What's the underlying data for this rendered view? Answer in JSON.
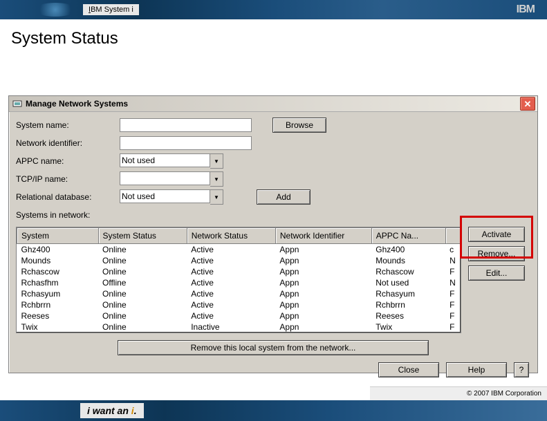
{
  "banner": {
    "label": "IBM System i",
    "logo": "IBM"
  },
  "page_title": "System Status",
  "dialog": {
    "title": "Manage Network Systems",
    "fields": {
      "system_name_label": "System name:",
      "system_name_value": "",
      "network_identifier_label": "Network identifier:",
      "network_identifier_value": "",
      "appc_name_label": "APPC name:",
      "appc_name_value": "Not used",
      "tcpip_name_label": "TCP/IP name:",
      "tcpip_name_value": "",
      "relational_db_label": "Relational database:",
      "relational_db_value": "Not used",
      "systems_in_network_label": "Systems in network:"
    },
    "buttons": {
      "browse": "Browse",
      "add": "Add",
      "activate": "Activate",
      "remove": "Remove...",
      "edit": "Edit...",
      "remove_local": "Remove this local system from the network...",
      "close": "Close",
      "help": "Help",
      "q": "?"
    },
    "table": {
      "headers": [
        "System",
        "System Status",
        "Network Status",
        "Network Identifier",
        "APPC Na...",
        ""
      ],
      "rows": [
        [
          "Ghz400",
          "Online",
          "Active",
          "Appn",
          "Ghz400",
          "c"
        ],
        [
          "Mounds",
          "Online",
          "Active",
          "Appn",
          "Mounds",
          "N"
        ],
        [
          "Rchascow",
          "Online",
          "Active",
          "Appn",
          "Rchascow",
          "F"
        ],
        [
          "Rchasfhm",
          "Offline",
          "Active",
          "Appn",
          "Not used",
          "N"
        ],
        [
          "Rchasyum",
          "Online",
          "Active",
          "Appn",
          "Rchasyum",
          "F"
        ],
        [
          "Rchbrrn",
          "Online",
          "Active",
          "Appn",
          "Rchbrrn",
          "F"
        ],
        [
          "Reeses",
          "Online",
          "Active",
          "Appn",
          "Reeses",
          "F"
        ],
        [
          "Twix",
          "Online",
          "Inactive",
          "Appn",
          "Twix",
          "F"
        ]
      ]
    }
  },
  "footer": {
    "tagline_pre": "i want an ",
    "tagline_i": "i",
    "tagline_post": "."
  },
  "copyright": "© 2007 IBM Corporation"
}
